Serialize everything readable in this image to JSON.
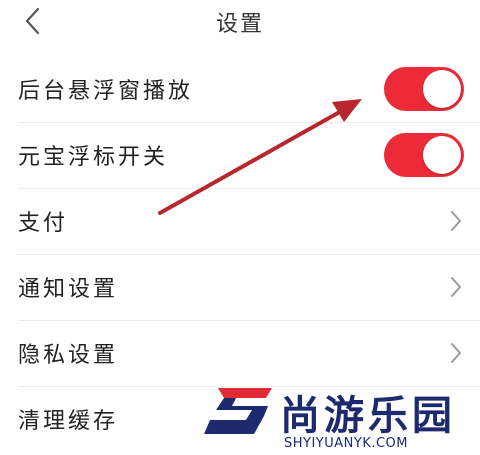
{
  "header": {
    "title": "设置"
  },
  "rows": [
    {
      "label": "后台悬浮窗播放",
      "control": "toggle",
      "on": true
    },
    {
      "label": "元宝浮标开关",
      "control": "toggle",
      "on": true
    },
    {
      "label": "支付",
      "control": "chevron"
    },
    {
      "label": "通知设置",
      "control": "chevron"
    },
    {
      "label": "隐私设置",
      "control": "chevron"
    },
    {
      "label": "清理缓存",
      "control": "none"
    }
  ],
  "watermark": {
    "name": "尚游乐园",
    "domain": "SHYIYUANYK.COM"
  },
  "colors": {
    "toggle_on": "#ec2a38",
    "arrow": "#b8262e",
    "watermark_blue": "#1e2a6e",
    "watermark_red": "#e02a36"
  },
  "icons": {
    "back": "chevron-left-icon",
    "row_arrow": "chevron-right-icon"
  }
}
